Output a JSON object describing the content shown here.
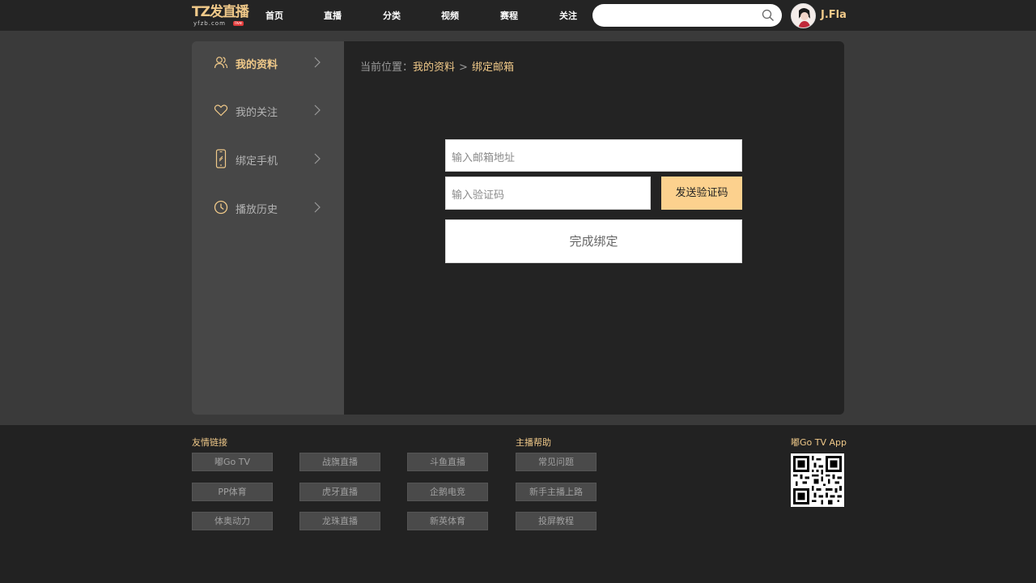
{
  "header": {
    "logo_text": "TZ发直播",
    "logo_domain": "yfzb.com",
    "logo_badge": "live",
    "nav": [
      "首页",
      "直播",
      "分类",
      "视频",
      "赛程",
      "关注"
    ],
    "search_placeholder": "",
    "username": "J.Fla"
  },
  "sidebar": {
    "items": [
      {
        "label": "我的资料",
        "icon": "user-profile-icon",
        "active": true
      },
      {
        "label": "我的关注",
        "icon": "heart-icon",
        "active": false
      },
      {
        "label": "绑定手机",
        "icon": "phone-icon",
        "active": false
      },
      {
        "label": "播放历史",
        "icon": "clock-icon",
        "active": false
      }
    ]
  },
  "main": {
    "breadcrumb": {
      "prefix": "当前位置：",
      "parent": "我的资料",
      "separator": ">",
      "current": "绑定邮箱"
    },
    "form": {
      "email_placeholder": "输入邮箱地址",
      "code_placeholder": "输入验证码",
      "send_code_label": "发送验证码",
      "submit_label": "完成绑定"
    }
  },
  "footer": {
    "friend_links_title": "友情链接",
    "friend_links": [
      "嘟Go TV",
      "战旗直播",
      "斗鱼直播",
      "PP体育",
      "虎牙直播",
      "企鹅电竞",
      "体奥动力",
      "龙珠直播",
      "新英体育"
    ],
    "anchor_help_title": "主播帮助",
    "anchor_help": [
      "常见问题",
      "新手主播上路",
      "投屏教程"
    ],
    "app_title": "嘟Go TV App"
  },
  "colors": {
    "accent": "#f0c989",
    "button": "#fcd18e",
    "background": "#222222",
    "sidebar": "#474747",
    "backdrop": "#3a3a3a"
  }
}
